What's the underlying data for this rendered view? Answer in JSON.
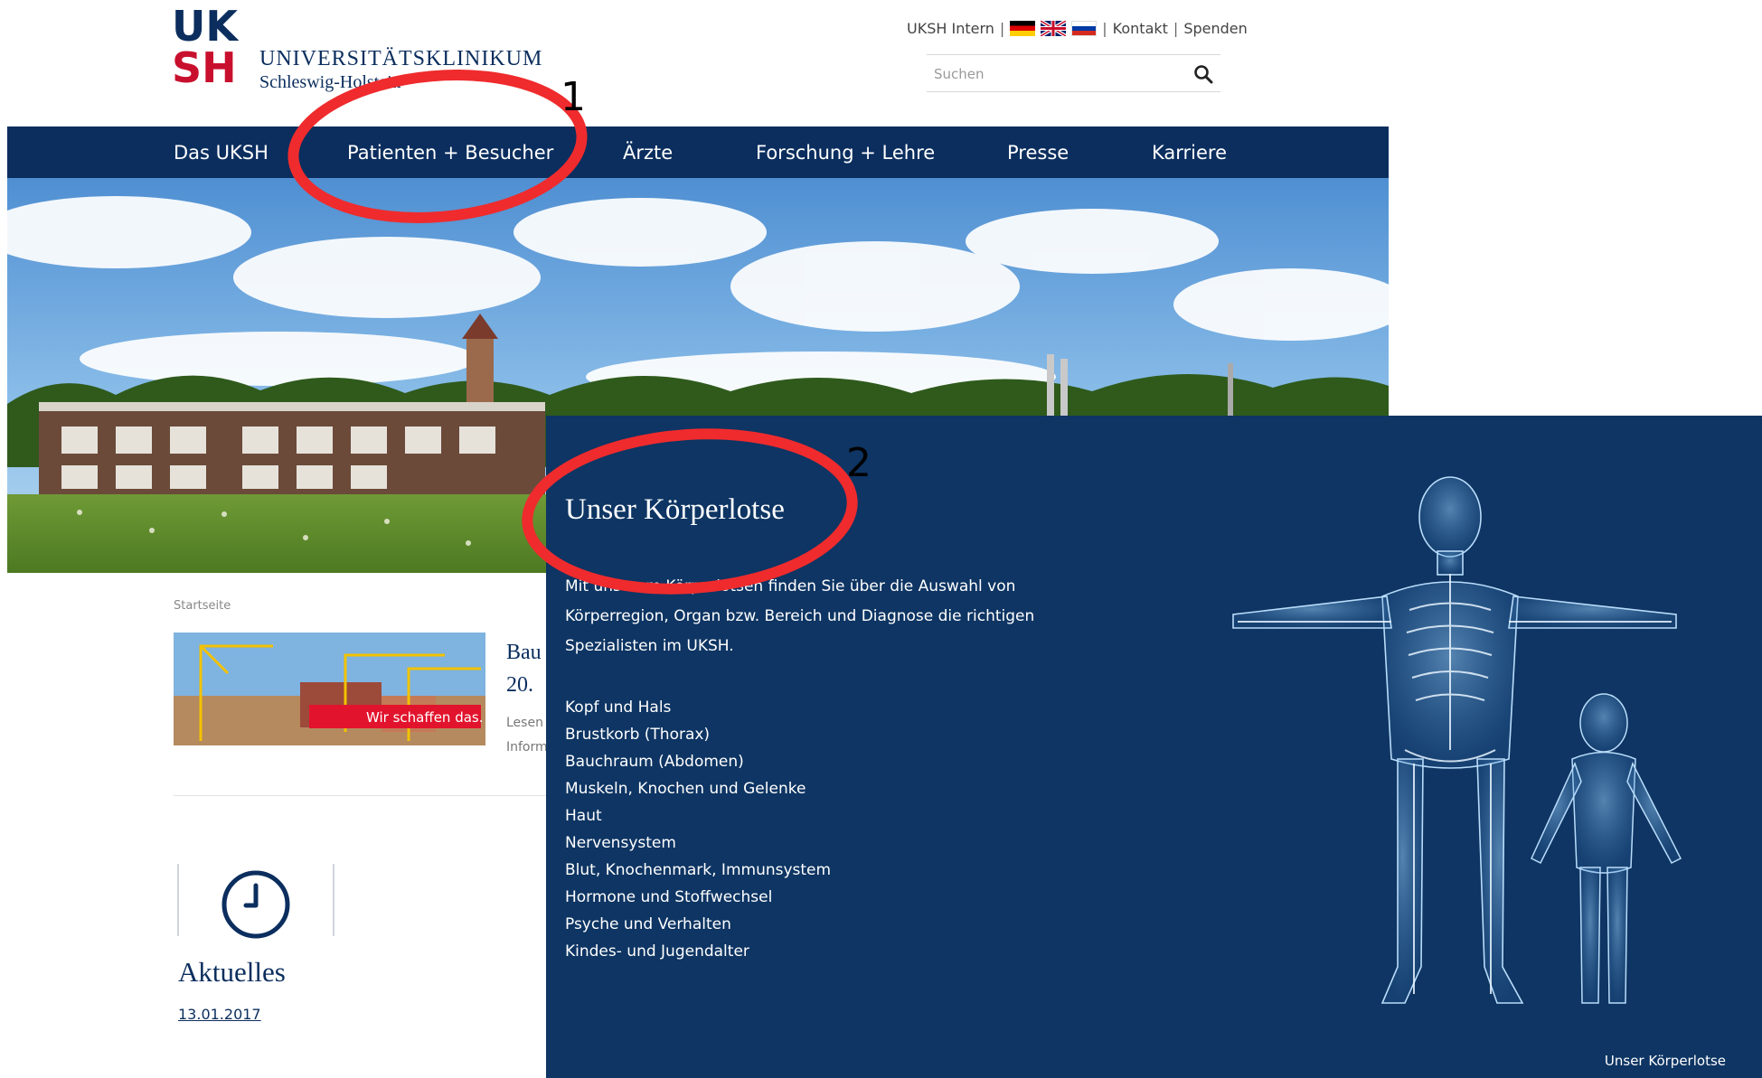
{
  "header": {
    "logo": {
      "line1": "UK",
      "line2": "SH",
      "name": "UNIVERSITÄTSKLINIKUM",
      "subname": "Schleswig-Holstein"
    },
    "toplinks": {
      "intern": "UKSH Intern",
      "contact": "Kontakt",
      "donate": "Spenden",
      "sep": "|"
    },
    "search": {
      "placeholder": "Suchen"
    }
  },
  "nav": {
    "items": [
      "Das UKSH",
      "Patienten + Besucher",
      "Ärzte",
      "Forschung + Lehre",
      "Presse",
      "Karriere"
    ]
  },
  "hero": {
    "banner_text": "Wir schaffen das."
  },
  "content": {
    "breadcrumb": "Startseite",
    "news": {
      "title_line1": "Bau",
      "title_line2": "20.",
      "sub_line1": "Lesen",
      "sub_line2": "Inform"
    },
    "aktuelles": {
      "heading": "Aktuelles",
      "date": "13.01.2017"
    }
  },
  "panel": {
    "title": "Unser Körperlotse",
    "intro_lines": [
      "Mit unserem Körperlotsen finden Sie über die Auswahl von",
      "Körperregion, Organ bzw. Bereich und Diagnose die richtigen",
      "Spezialisten im UKSH."
    ],
    "regions": [
      "Kopf und Hals",
      "Brustkorb (Thorax)",
      "Bauchraum (Abdomen)",
      "Muskeln, Knochen und Gelenke",
      "Haut",
      "Nervensystem",
      "Blut, Knochenmark, Immunsystem",
      "Hormone und Stoffwechsel",
      "Psyche und Verhalten",
      "Kindes- und Jugendalter"
    ],
    "footer": "Unser Körperlotse"
  },
  "annotations": {
    "marker1": "1",
    "marker2": "2"
  },
  "colors": {
    "brand_blue": "#0b2e5e",
    "brand_red": "#c8102e",
    "panel_bg": "#0e3563",
    "annotation_red": "#ef2b2d"
  }
}
